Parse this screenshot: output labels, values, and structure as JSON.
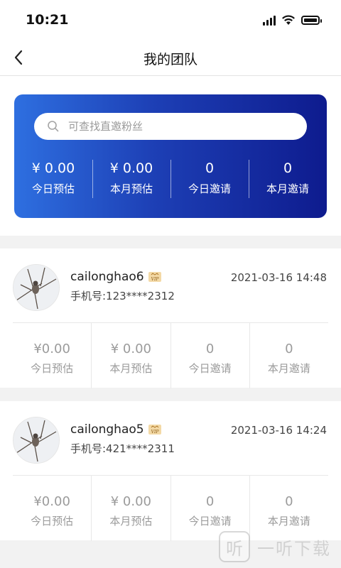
{
  "status_bar": {
    "time": "10:21"
  },
  "nav": {
    "title": "我的团队"
  },
  "summary": {
    "search_placeholder": "可查找直邀粉丝",
    "stats": [
      {
        "value": "¥ 0.00",
        "label": "今日预估"
      },
      {
        "value": "¥ 0.00",
        "label": "本月预估"
      },
      {
        "value": "0",
        "label": "今日邀请"
      },
      {
        "value": "0",
        "label": "本月邀请"
      }
    ]
  },
  "members": [
    {
      "username": "cailonghao6",
      "phone": "手机号:123****2312",
      "date": "2021-03-16 14:48",
      "stats": [
        {
          "value": "¥0.00",
          "label": "今日预估"
        },
        {
          "value": "¥ 0.00",
          "label": "本月预估"
        },
        {
          "value": "0",
          "label": "今日邀请"
        },
        {
          "value": "0",
          "label": "本月邀请"
        }
      ]
    },
    {
      "username": "cailonghao5",
      "phone": "手机号:421****2311",
      "date": "2021-03-16 14:24",
      "stats": [
        {
          "value": "¥0.00",
          "label": "今日预估"
        },
        {
          "value": "¥ 0.00",
          "label": "本月预估"
        },
        {
          "value": "0",
          "label": "今日邀请"
        },
        {
          "value": "0",
          "label": "本月邀请"
        }
      ]
    }
  ],
  "watermark": {
    "glyph": "听",
    "text": "一听下载"
  },
  "icons": [
    "signal-icon",
    "wifi-icon",
    "battery-icon",
    "back-arrow-icon",
    "search-icon",
    "vip-badge-icon",
    "avatar-bird-image"
  ],
  "colors": {
    "card_gradient_start": "#2e6fe0",
    "card_gradient_end": "#0e1b8e",
    "muted_text": "#9b9b9b"
  }
}
